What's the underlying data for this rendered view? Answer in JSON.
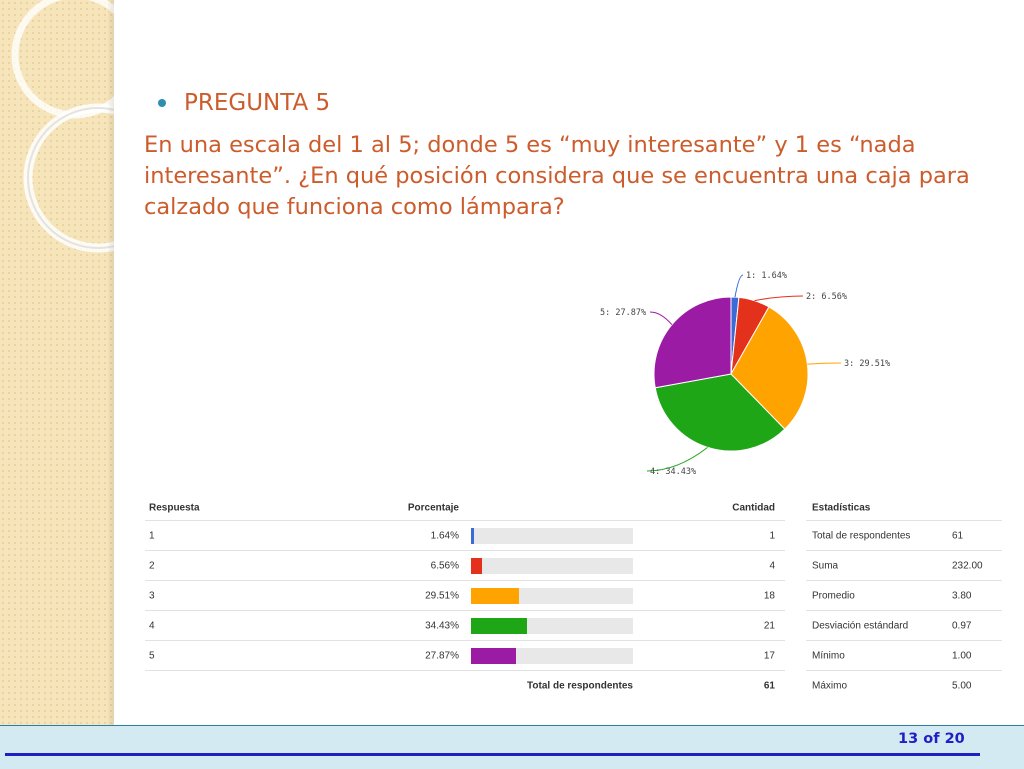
{
  "slide": {
    "heading": "PREGUNTA 5",
    "question": "En una escala del 1 al 5; donde 5 es “muy interesante” y 1 es “nada interesante”. ¿En qué posición considera que se encuentra una caja para calzado que funciona como lámpara?",
    "page": {
      "current": "13",
      "sep": "of",
      "total": "20"
    }
  },
  "colors": {
    "accent_text": "#cc5c2c",
    "page_text": "#1f1fc6",
    "bar_track": "#e8e8e8"
  },
  "table": {
    "headers": {
      "answer": "Respuesta",
      "percent": "Porcentaje",
      "count": "Cantidad"
    },
    "total_label": "Total de respondentes",
    "total_value": "61"
  },
  "stats": {
    "header": "Estadísticas",
    "rows": [
      {
        "label": "Total de respondentes",
        "value": "61"
      },
      {
        "label": "Suma",
        "value": "232.00"
      },
      {
        "label": "Promedio",
        "value": "3.80"
      },
      {
        "label": "Desviación estándard",
        "value": "0.97"
      },
      {
        "label": "Mínimo",
        "value": "1.00"
      },
      {
        "label": "Máximo",
        "value": "5.00"
      }
    ]
  },
  "chart_data": {
    "type": "pie",
    "categories": [
      "1",
      "2",
      "3",
      "4",
      "5"
    ],
    "values": [
      1.64,
      6.56,
      29.51,
      34.43,
      27.87
    ],
    "percent_labels": [
      "1.64%",
      "6.56%",
      "29.51%",
      "34.43%",
      "27.87%"
    ],
    "counts": [
      1,
      4,
      18,
      21,
      17
    ],
    "slice_labels": [
      "1: 1.64%",
      "2: 6.56%",
      "3: 29.51%",
      "4: 34.43%",
      "5: 27.87%"
    ],
    "colors": [
      "#3b6bd6",
      "#e3311b",
      "#ffa300",
      "#1ea617",
      "#9c1ba4"
    ]
  }
}
